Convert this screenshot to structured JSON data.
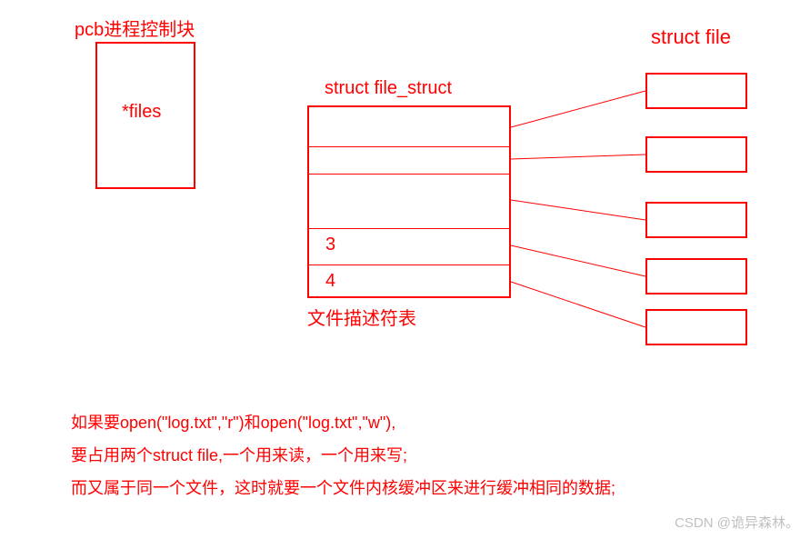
{
  "pcb": {
    "title": "pcb进程控制块",
    "inner": "*files"
  },
  "file_struct": {
    "title": "struct file_struct",
    "caption": "文件描述符表",
    "rows": [
      {
        "num": ""
      },
      {
        "num": ""
      },
      {
        "num": ""
      },
      {
        "num": "3"
      },
      {
        "num": "4"
      }
    ]
  },
  "struct_file": {
    "title": "struct file"
  },
  "explain": {
    "line1": "如果要open(\"log.txt\",\"r\")和open(\"log.txt\",\"w\"),",
    "line2": "要占用两个struct file,一个用来读，一个用来写;",
    "line3": "而又属于同一个文件，这时就要一个文件内核缓冲区来进行缓冲相同的数据;"
  },
  "watermark": "CSDN @诡异森林。",
  "chart_data": {
    "type": "diagram",
    "nodes": [
      {
        "id": "pcb",
        "label": "pcb进程控制块",
        "contains": "*files"
      },
      {
        "id": "file_struct",
        "label": "struct file_struct / 文件描述符表",
        "slots": [
          "",
          "",
          "",
          "3",
          "4"
        ]
      },
      {
        "id": "struct_file_1",
        "label": "struct file"
      },
      {
        "id": "struct_file_2",
        "label": "struct file"
      },
      {
        "id": "struct_file_3",
        "label": "struct file"
      },
      {
        "id": "struct_file_4",
        "label": "struct file"
      },
      {
        "id": "struct_file_5",
        "label": "struct file"
      }
    ],
    "edges": [
      {
        "from": "file_struct[0]",
        "to": "struct_file_1"
      },
      {
        "from": "file_struct[1]",
        "to": "struct_file_2"
      },
      {
        "from": "file_struct[2]",
        "to": "struct_file_3"
      },
      {
        "from": "file_struct[3]",
        "to": "struct_file_4"
      },
      {
        "from": "file_struct[4]",
        "to": "struct_file_5"
      }
    ],
    "note": "file_struct holds file descriptors; each entry points to a struct file; opening same file for r and w uses two struct file entries sharing one kernel buffer"
  }
}
